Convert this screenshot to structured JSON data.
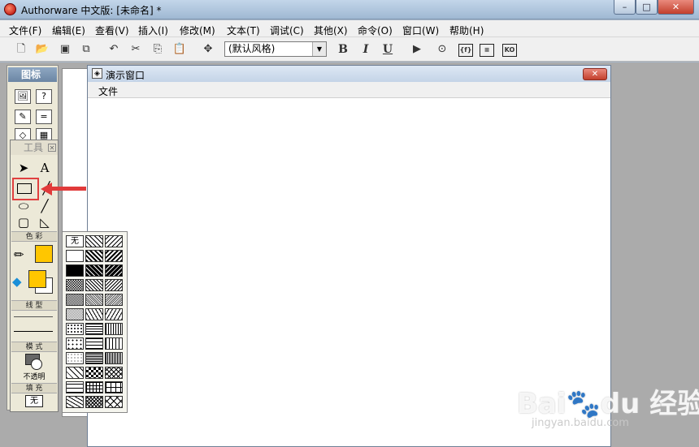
{
  "window": {
    "title": "Authorware 中文版: [未命名] *",
    "minimize": "–",
    "maximize": "□",
    "close": "✕"
  },
  "menu": [
    "文件(F)",
    "编辑(E)",
    "查看(V)",
    "插入(I)",
    "修改(M)",
    "文本(T)",
    "调试(C)",
    "其他(X)",
    "命令(O)",
    "窗口(W)",
    "帮助(H)"
  ],
  "toolbar": {
    "style_value": "(默认风格)",
    "bold": "B",
    "italic": "I",
    "underline": "U"
  },
  "icon_palette": {
    "title": "图标"
  },
  "presentation": {
    "title": "演示窗口",
    "menu_file": "文件"
  },
  "tools": {
    "title": "工具",
    "color_section": "色 彩",
    "line_section": "线 型",
    "mode_section": "模 式",
    "mode_value": "不透明",
    "fill_section": "填 充",
    "fill_value": "无"
  },
  "patterns": {
    "none": "无"
  },
  "watermark": {
    "brand": "Bai🐾du 经验",
    "url": "jingyan.baidu.com"
  },
  "colors": {
    "highlight": "#e04040",
    "fill_yellow": "#ffc600",
    "accent": "#e13a3a"
  }
}
